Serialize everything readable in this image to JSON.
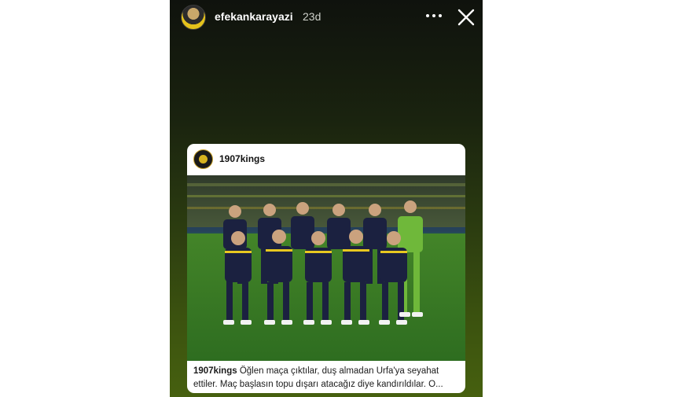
{
  "story": {
    "username": "efekankarayazi",
    "time": "23d",
    "icons": [
      "more-icon",
      "close-icon"
    ]
  },
  "post": {
    "account": "1907kings",
    "caption_user": "1907kings",
    "caption_text": "Öğlen maça çıktılar, duş almadan Urfa'ya seyahat ettiler. Maç başlasın topu dışarı atacağız diye kandırıldılar. O..."
  },
  "colors": {
    "story_bg_top": "#0f120d",
    "story_bg_bottom": "#46600f",
    "jersey": "#1b2140",
    "pitch": "#3f8a2a"
  }
}
